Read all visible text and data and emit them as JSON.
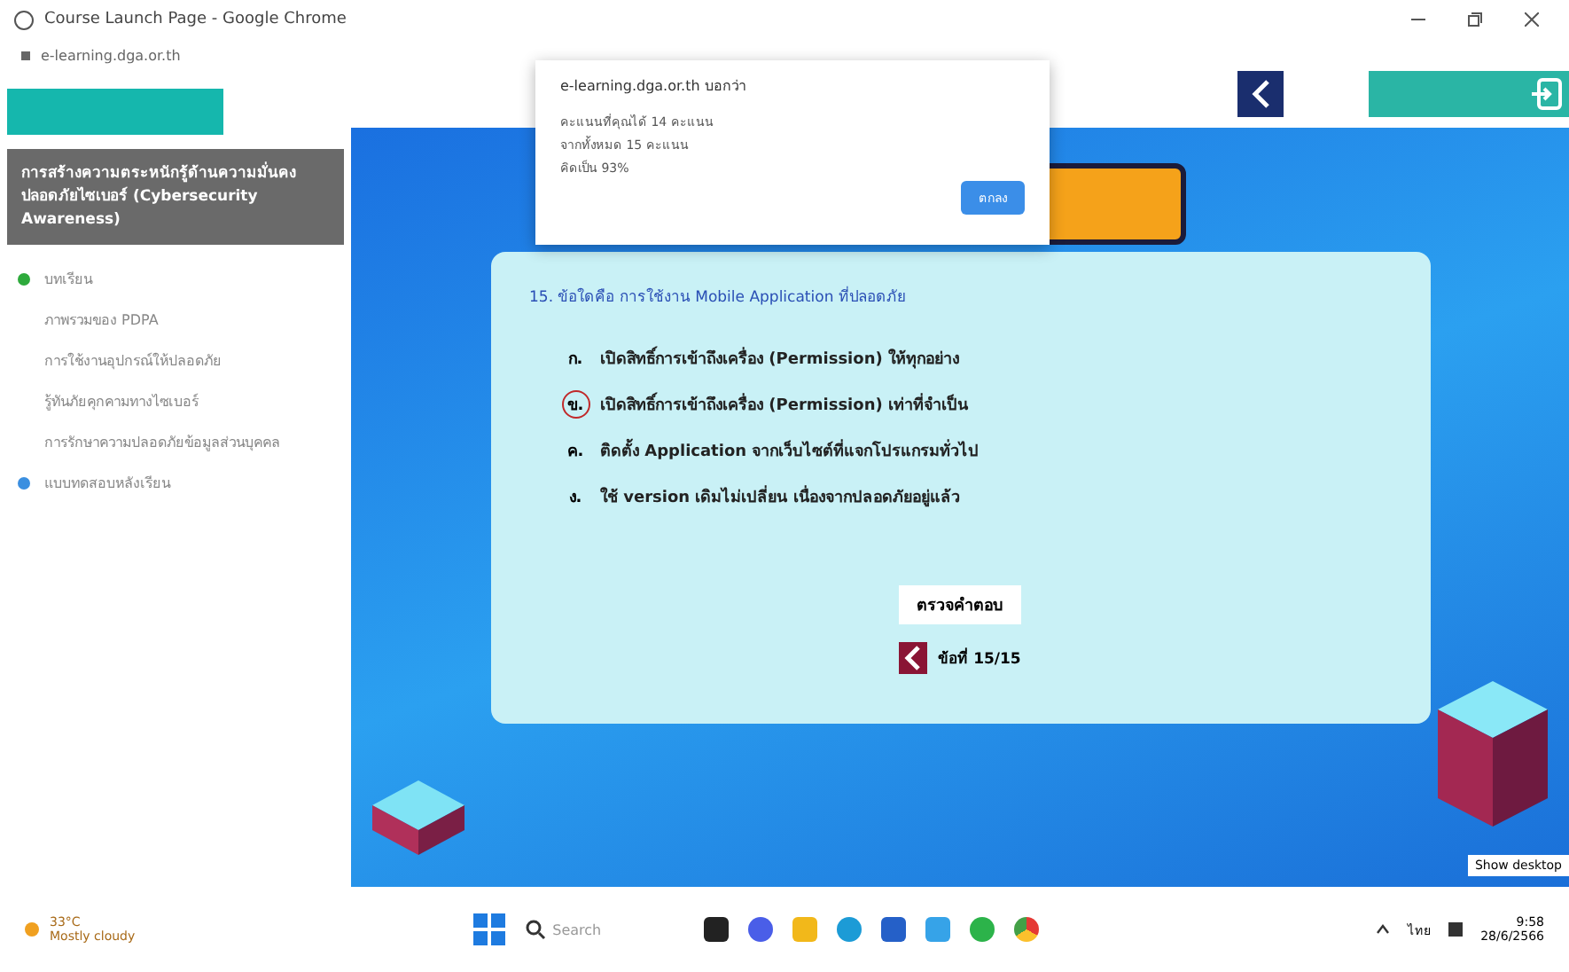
{
  "window": {
    "title": "Course Launch Page - Google Chrome",
    "url": "e-learning.dga.or.th"
  },
  "sidebar": {
    "course_title": "การสร้างความตระหนักรู้ด้านความมั่นคงปลอดภัยไซเบอร์ (Cybersecurity Awareness)",
    "items": [
      {
        "label": "บทเรียน",
        "color": "#2eaa3c"
      },
      {
        "label": "ภาพรวมของ PDPA"
      },
      {
        "label": "การใช้งานอุปกรณ์ให้ปลอดภัย"
      },
      {
        "label": "รู้ทันภัยคุกคามทางไซเบอร์"
      },
      {
        "label": "การรักษาความปลอดภัยข้อมูลส่วนบุคคล"
      },
      {
        "label": "แบบทดสอบหลังเรียน",
        "color": "#3b8fe0"
      }
    ]
  },
  "dialog": {
    "origin": "e-learning.dga.or.th บอกว่า",
    "lines": [
      "คะแนนที่คุณได้ 14 คะแนน",
      "จากทั้งหมด 15 คะแนน",
      "คิดเป็น 93%"
    ],
    "button": "ตกลง"
  },
  "quiz": {
    "question": "15. ข้อใดคือ การใช้งาน Mobile Application ที่ปลอดภัย",
    "choices": [
      {
        "letter": "ก.",
        "text": "เปิดสิทธิ์การเข้าถึงเครื่อง (Permission) ให้ทุกอย่าง",
        "selected": false
      },
      {
        "letter": "ข.",
        "text": "เปิดสิทธิ์การเข้าถึงเครื่อง (Permission) เท่าที่จำเป็น",
        "selected": true
      },
      {
        "letter": "ค.",
        "text": "ติดตั้ง Application จากเว็บไซต์ที่แจกโปรแกรมทั่วไป",
        "selected": false
      },
      {
        "letter": "ง.",
        "text": "ใช้ version เดิมไม่เปลี่ยน เนื่องจากปลอดภัยอยู่แล้ว",
        "selected": false
      }
    ],
    "check_button": "ตรวจคำตอบ",
    "page": "ข้อที่ 15/15"
  },
  "tooltip": "Show desktop",
  "taskbar": {
    "weather_temp": "33°C",
    "weather_text": "Mostly cloudy",
    "search": "Search",
    "lang": "ไทย",
    "time": "9:58",
    "date": "28/6/2566"
  }
}
